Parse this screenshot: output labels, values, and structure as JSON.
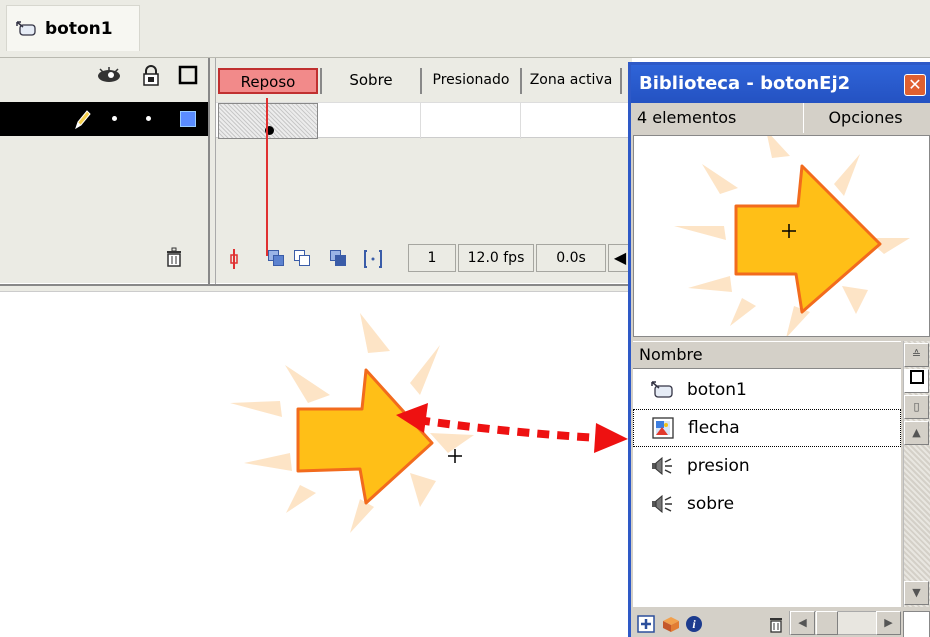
{
  "breadcrumb": {
    "symbol_name": "boton1",
    "icon": "button-symbol-icon"
  },
  "timeline": {
    "layer_header_icons": [
      "eye-icon",
      "lock-icon",
      "outline-square-icon"
    ],
    "states": [
      "Reposo",
      "Sobre",
      "Presionado",
      "Zona activa"
    ],
    "active_state": "Reposo",
    "current_frame": "1",
    "frame_rate": "12.0 fps",
    "elapsed_time": "0.0s",
    "colors": {
      "active_state_fill": "#f28a8a",
      "playhead": "#e03030",
      "layer_selected_bg": "#000000",
      "layer_outline_color": "#5a8cff"
    }
  },
  "stage": {
    "instance": "flecha",
    "colors": {
      "arrow_fill": "#ffbf17",
      "arrow_stroke": "#f26b1d",
      "burst": "#fde4c6",
      "drag_arrow": "#ee1111"
    }
  },
  "library": {
    "title": "Biblioteca - botonEj2",
    "item_count": "4 elementos",
    "options_label": "Opciones",
    "column_name": "Nombre",
    "items": [
      {
        "label": "boton1",
        "icon": "button-symbol-icon"
      },
      {
        "label": "flecha",
        "icon": "bitmap-icon",
        "selected": true
      },
      {
        "label": "presion",
        "icon": "sound-icon"
      },
      {
        "label": "sobre",
        "icon": "sound-icon"
      }
    ],
    "footer_icons": [
      "new-symbol-icon",
      "new-folder-icon",
      "properties-icon",
      "delete-icon"
    ],
    "colors": {
      "titlebar": "#2452c2",
      "close": "#e06030"
    }
  }
}
